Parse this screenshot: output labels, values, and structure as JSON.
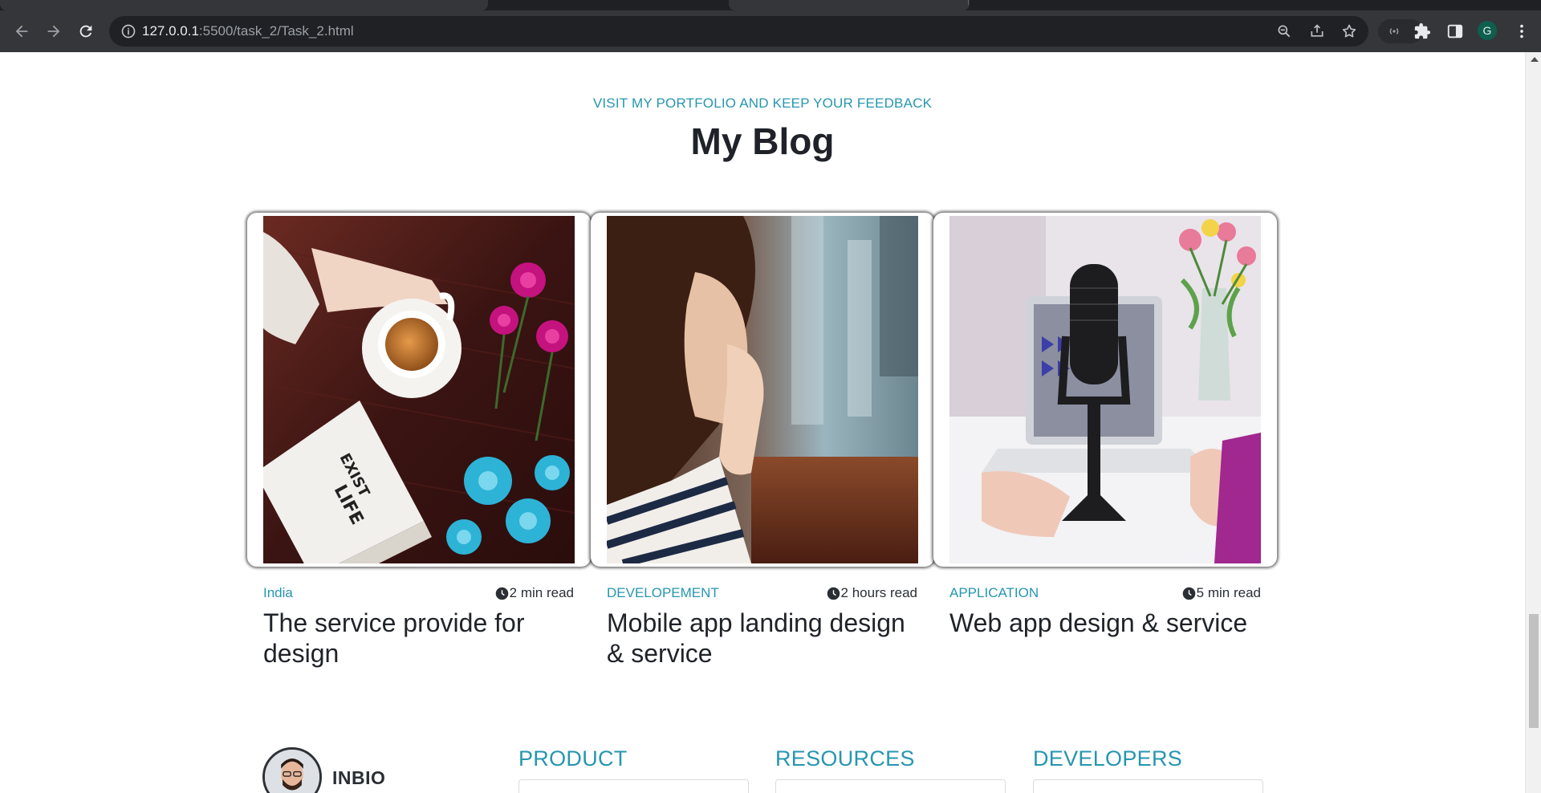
{
  "browser": {
    "url_host": "127.0.0.1",
    "url_path": ":5500/task_2/Task_2.html",
    "profile_initial": "G"
  },
  "section": {
    "subtitle": "VISIT MY PORTFOLIO AND KEEP YOUR FEEDBACK",
    "title": "My Blog"
  },
  "posts": [
    {
      "category": "India",
      "read_time": "2 min read",
      "title": "The service provide for design"
    },
    {
      "category": "DEVELOPEMENT",
      "read_time": "2 hours read",
      "title": "Mobile app landing design & service"
    },
    {
      "category": "APPLICATION",
      "read_time": "5 min read",
      "title": "Web app design & service"
    }
  ],
  "footer": {
    "brand": "INBIO",
    "columns": [
      "PRODUCT",
      "RESOURCES",
      "DEVELOPERS"
    ]
  },
  "colors": {
    "accent": "#2696b0",
    "heading": "#1f2329",
    "chrome_bg": "#35363a"
  }
}
